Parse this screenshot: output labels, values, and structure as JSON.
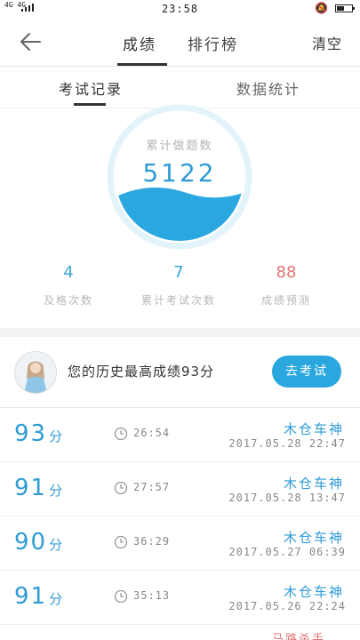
{
  "status_bar": {
    "network": "4G 4G",
    "time": "23:58"
  },
  "header": {
    "tabs": [
      {
        "label": "成绩",
        "active": true
      },
      {
        "label": "排行榜",
        "active": false
      }
    ],
    "clear_label": "清空"
  },
  "subtabs": [
    {
      "label": "考试记录",
      "active": true
    },
    {
      "label": "数据统计",
      "active": false
    }
  ],
  "summary": {
    "gauge_label": "累计做题数",
    "gauge_value": "5122",
    "stats": [
      {
        "value": "4",
        "label": "及格次数"
      },
      {
        "value": "7",
        "label": "累计考试次数"
      },
      {
        "value": "88",
        "label": "成绩预测"
      }
    ]
  },
  "best": {
    "text": "您的历史最高成绩93分",
    "button_label": "去考试"
  },
  "records": [
    {
      "score": "93",
      "unit": "分",
      "duration": "26:54",
      "name": "木仓车神",
      "date": "2017.05.28  22:47"
    },
    {
      "score": "91",
      "unit": "分",
      "duration": "27:57",
      "name": "木仓车神",
      "date": "2017.05.28  13:47"
    },
    {
      "score": "90",
      "unit": "分",
      "duration": "36:29",
      "name": "木仓车神",
      "date": "2017.05.27  06:39"
    },
    {
      "score": "91",
      "unit": "分",
      "duration": "35:13",
      "name": "木仓车神",
      "date": "2017.05.26  22:24"
    }
  ],
  "peek_text": "马路杀手",
  "colors": {
    "accent": "#2aa7df",
    "score_blue": "#2f9bd6",
    "prediction_red": "#e57373",
    "gauge_ring": "#e3f3fb"
  }
}
